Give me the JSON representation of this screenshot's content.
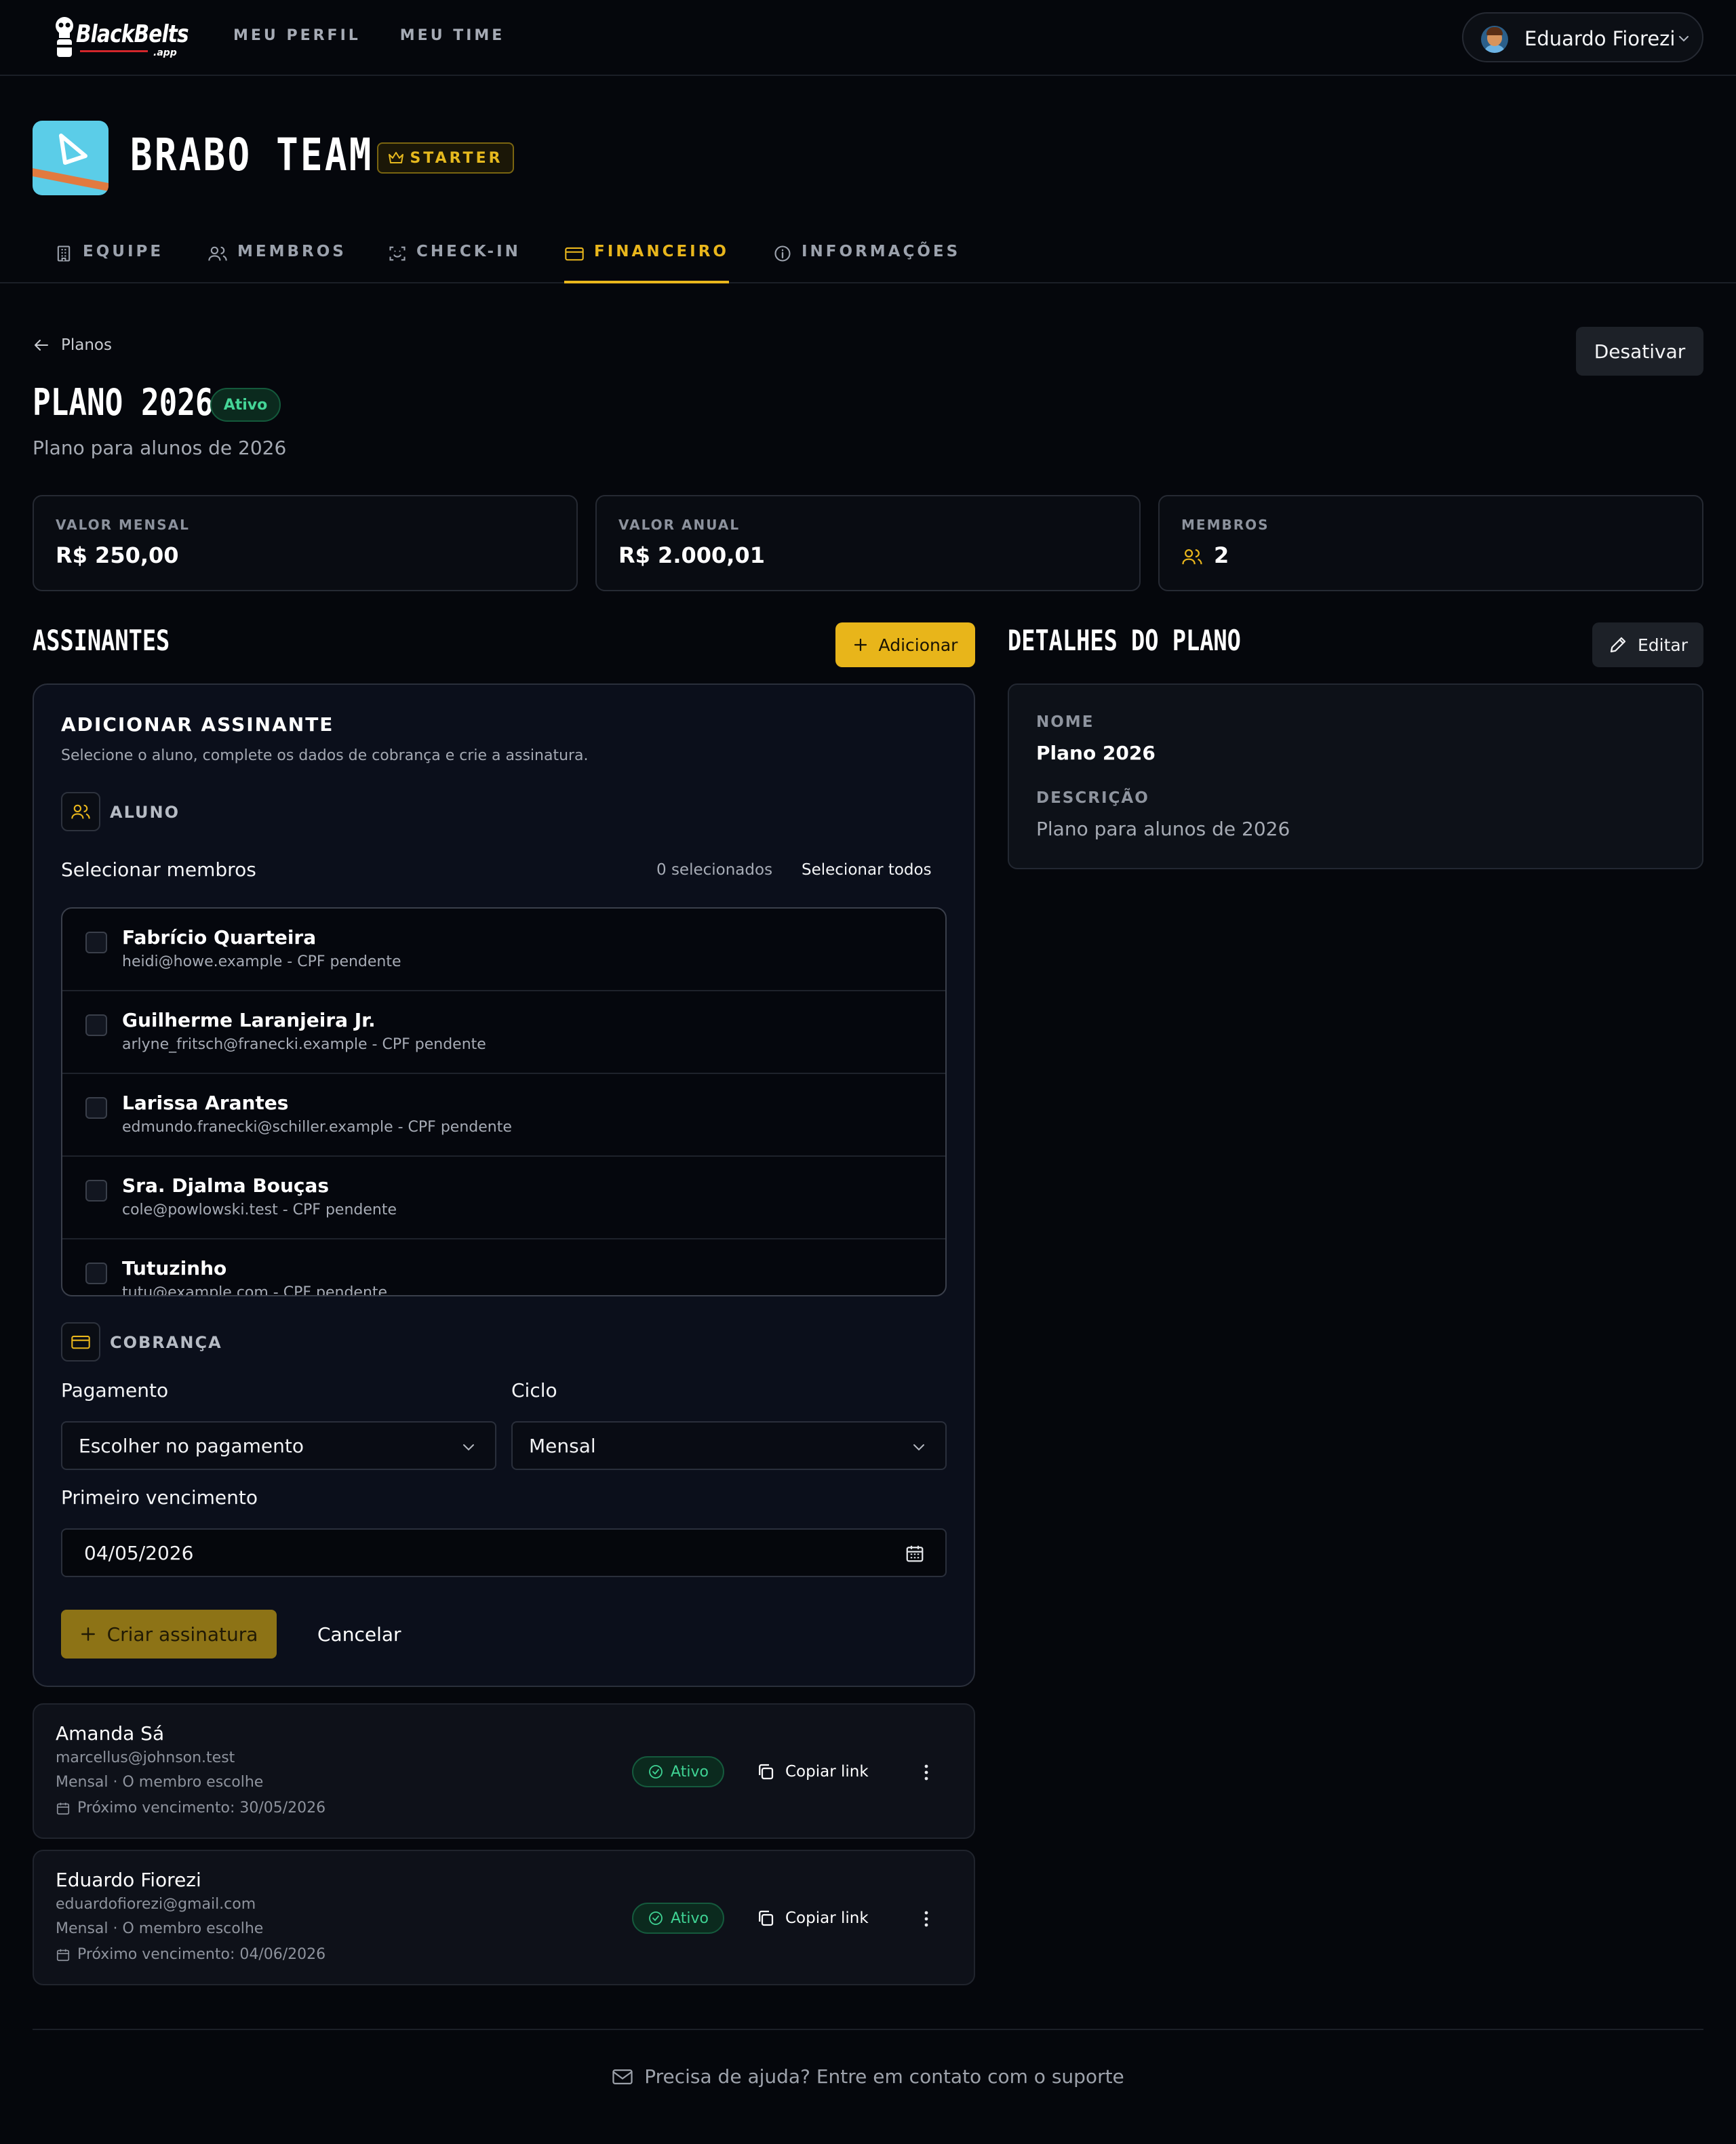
{
  "brand": {
    "name": "BlackBelts",
    "suffix": ".app"
  },
  "nav": {
    "items": [
      "MEU PERFIL",
      "MEU TIME"
    ]
  },
  "user": {
    "name": "Eduardo Fiorezi"
  },
  "team": {
    "name": "BRABO TEAM",
    "plan_badge": "STARTER"
  },
  "tabs": [
    {
      "label": "EQUIPE",
      "icon": "building-icon"
    },
    {
      "label": "MEMBROS",
      "icon": "users-icon"
    },
    {
      "label": "CHECK-IN",
      "icon": "scan-face-icon"
    },
    {
      "label": "FINANCEIRO",
      "icon": "credit-card-icon",
      "active": true
    },
    {
      "label": "INFORMAÇÕES",
      "icon": "info-icon"
    }
  ],
  "plan": {
    "breadcrumb": "Planos",
    "deactivate_label": "Desativar",
    "title": "PLANO 2026",
    "status": "Ativo",
    "subtitle": "Plano para alunos de 2026"
  },
  "stats": [
    {
      "label": "VALOR MENSAL",
      "value": "R$ 250,00"
    },
    {
      "label": "VALOR ANUAL",
      "value": "R$ 2.000,01"
    },
    {
      "label": "MEMBROS",
      "value": "2"
    }
  ],
  "subscribers": {
    "title": "ASSINANTES",
    "add_label": "Adicionar",
    "form": {
      "title": "ADICIONAR ASSINANTE",
      "description": "Selecione o aluno, complete os dados de cobrança e crie a assinatura.",
      "student_section": "ALUNO",
      "select_label": "Selecionar membros",
      "selected_count": "0 selecionados",
      "select_all": "Selecionar todos",
      "members": [
        {
          "name": "Fabrício Quarteira",
          "detail": "heidi@howe.example - CPF pendente"
        },
        {
          "name": "Guilherme Laranjeira Jr.",
          "detail": "arlyne_fritsch@franecki.example - CPF pendente"
        },
        {
          "name": "Larissa Arantes",
          "detail": "edmundo.franecki@schiller.example - CPF pendente"
        },
        {
          "name": "Sra. Djalma Bouças",
          "detail": "cole@powlowski.test - CPF pendente"
        },
        {
          "name": "Tutuzinho",
          "detail": "tutu@example.com - CPF pendente"
        }
      ],
      "billing_section": "COBRANÇA",
      "payment_label": "Pagamento",
      "payment_value": "Escolher no pagamento",
      "cycle_label": "Ciclo",
      "cycle_value": "Mensal",
      "first_due_label": "Primeiro vencimento",
      "first_due_value": "04/05/2026",
      "create_label": "Criar assinatura",
      "cancel_label": "Cancelar"
    },
    "list": [
      {
        "name": "Amanda Sá",
        "email": "marcellus@johnson.test",
        "plan": "Mensal · O membro escolhe",
        "next_due": "Próximo vencimento: 30/05/2026",
        "status": "Ativo",
        "copy_label": "Copiar link"
      },
      {
        "name": "Eduardo Fiorezi",
        "email": "eduardofiorezi@gmail.com",
        "plan": "Mensal · O membro escolhe",
        "next_due": "Próximo vencimento: 04/06/2026",
        "status": "Ativo",
        "copy_label": "Copiar link"
      }
    ]
  },
  "details": {
    "title": "DETALHES DO PLANO",
    "edit_label": "Editar",
    "name_label": "NOME",
    "name_value": "Plano 2026",
    "desc_label": "DESCRIÇÃO",
    "desc_value": "Plano para alunos de 2026"
  },
  "footer": {
    "text": "Precisa de ajuda? Entre em contato com o suporte"
  },
  "colors": {
    "accent": "#e8b51a",
    "success": "#3fd394",
    "background": "#05070c"
  }
}
